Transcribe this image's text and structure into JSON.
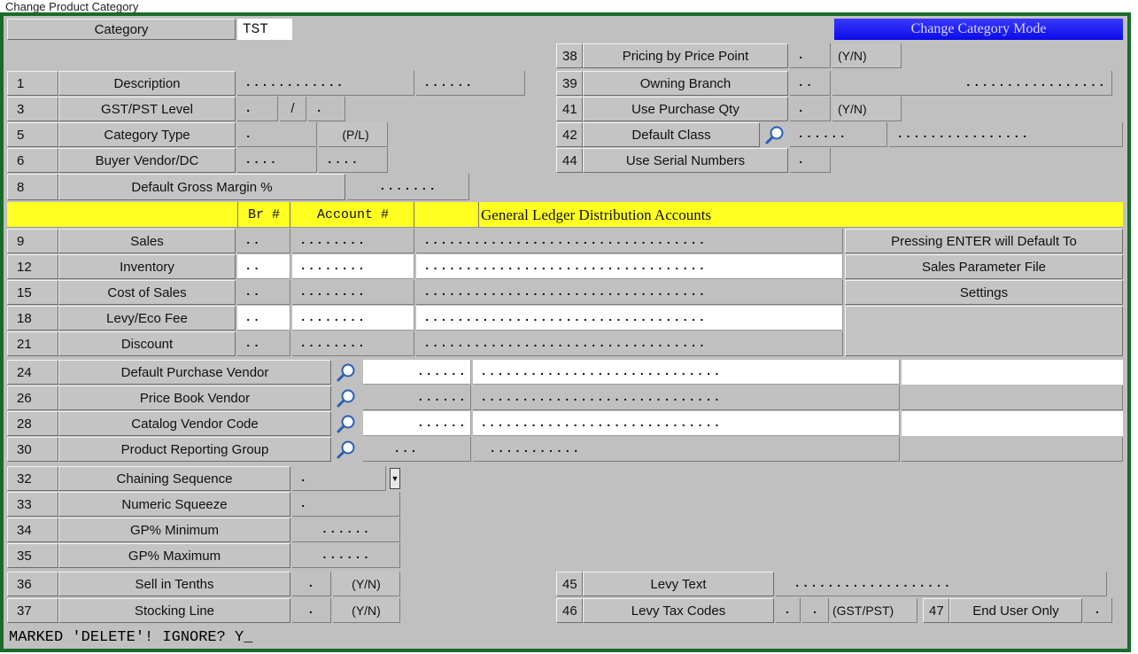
{
  "window": {
    "title": "Change Product Category"
  },
  "header": {
    "category_label": "Category",
    "category_value": "TST",
    "mode_label": "Change Category Mode"
  },
  "left_fields": {
    "f1": {
      "num": "1",
      "label": "Description",
      "value1": "............",
      "value2": "......"
    },
    "f3": {
      "num": "3",
      "label": "GST/PST Level",
      "value1": ".",
      "sep": "/",
      "value2": "."
    },
    "f5": {
      "num": "5",
      "label": "Category Type",
      "value": ".",
      "hint": "(P/L)"
    },
    "f6": {
      "num": "6",
      "label": "Buyer Vendor/DC",
      "value1": "....",
      "value2": "...."
    },
    "f8": {
      "num": "8",
      "label": "Default Gross Margin %",
      "value": "......."
    }
  },
  "right_fields": {
    "f38": {
      "num": "38",
      "label": "Pricing by Price Point",
      "value": ".",
      "hint": "(Y/N)"
    },
    "f39": {
      "num": "39",
      "label": "Owning Branch",
      "value1": "..",
      "value2": "................."
    },
    "f41": {
      "num": "41",
      "label": "Use Purchase Qty",
      "value": ".",
      "hint": "(Y/N)"
    },
    "f42": {
      "num": "42",
      "label": "Default Class",
      "value1": "......",
      "value2": "................"
    },
    "f44": {
      "num": "44",
      "label": "Use Serial Numbers",
      "value": "."
    }
  },
  "gl": {
    "header_br": "Br #",
    "header_account": "Account #",
    "header_title": "General Ledger Distribution Accounts",
    "rows": [
      {
        "num": "9",
        "label": "Sales",
        "br": "..",
        "acct": "........",
        "desc": ".................................."
      },
      {
        "num": "12",
        "label": "Inventory",
        "br": "..",
        "acct": "........",
        "desc": ".................................."
      },
      {
        "num": "15",
        "label": "Cost of Sales",
        "br": "..",
        "acct": "........",
        "desc": ".................................."
      },
      {
        "num": "18",
        "label": "Levy/Eco Fee",
        "br": "..",
        "acct": "........",
        "desc": ".................................."
      },
      {
        "num": "21",
        "label": "Discount",
        "br": "..",
        "acct": "........",
        "desc": ".................................."
      }
    ],
    "note1": "Pressing ENTER will Default To",
    "note2": "Sales Parameter File",
    "note3": "Settings"
  },
  "vendors": [
    {
      "num": "24",
      "label": "Default Purchase Vendor",
      "code": "......",
      "name": "............................."
    },
    {
      "num": "26",
      "label": "Price Book Vendor",
      "code": "......",
      "name": "............................."
    },
    {
      "num": "28",
      "label": "Catalog Vendor Code",
      "code": "......",
      "name": "............................."
    },
    {
      "num": "30",
      "label": "Product Reporting Group",
      "code": "...",
      "name": "..........."
    }
  ],
  "lower": {
    "f32": {
      "num": "32",
      "label": "Chaining Sequence",
      "value": ".",
      "arrow": "▼"
    },
    "f33": {
      "num": "33",
      "label": "Numeric Squeeze",
      "value": "."
    },
    "f34": {
      "num": "34",
      "label": "GP% Minimum",
      "value": "......"
    },
    "f35": {
      "num": "35",
      "label": "GP% Maximum",
      "value": "......"
    },
    "f36": {
      "num": "36",
      "label": "Sell in Tenths",
      "value": ".",
      "hint": "(Y/N)"
    },
    "f37": {
      "num": "37",
      "label": "Stocking Line",
      "value": ".",
      "hint": "(Y/N)"
    },
    "f45": {
      "num": "45",
      "label": "Levy Text",
      "value": "..................."
    },
    "f46": {
      "num": "46",
      "label": "Levy Tax Codes",
      "value1": ".",
      "value2": ".",
      "hint": "(GST/PST)"
    },
    "f47": {
      "num": "47",
      "label": "End User Only",
      "value": "."
    }
  },
  "prompt": {
    "text": "MARKED 'DELETE'!  IGNORE? Y_"
  },
  "icons": {
    "lookup": "magnifier-icon",
    "dropdown": "dropdown-arrow-icon"
  },
  "colors": {
    "frame": "#1a6b2a",
    "mode_button": "#1010ee",
    "gl_header": "#ffff22"
  }
}
